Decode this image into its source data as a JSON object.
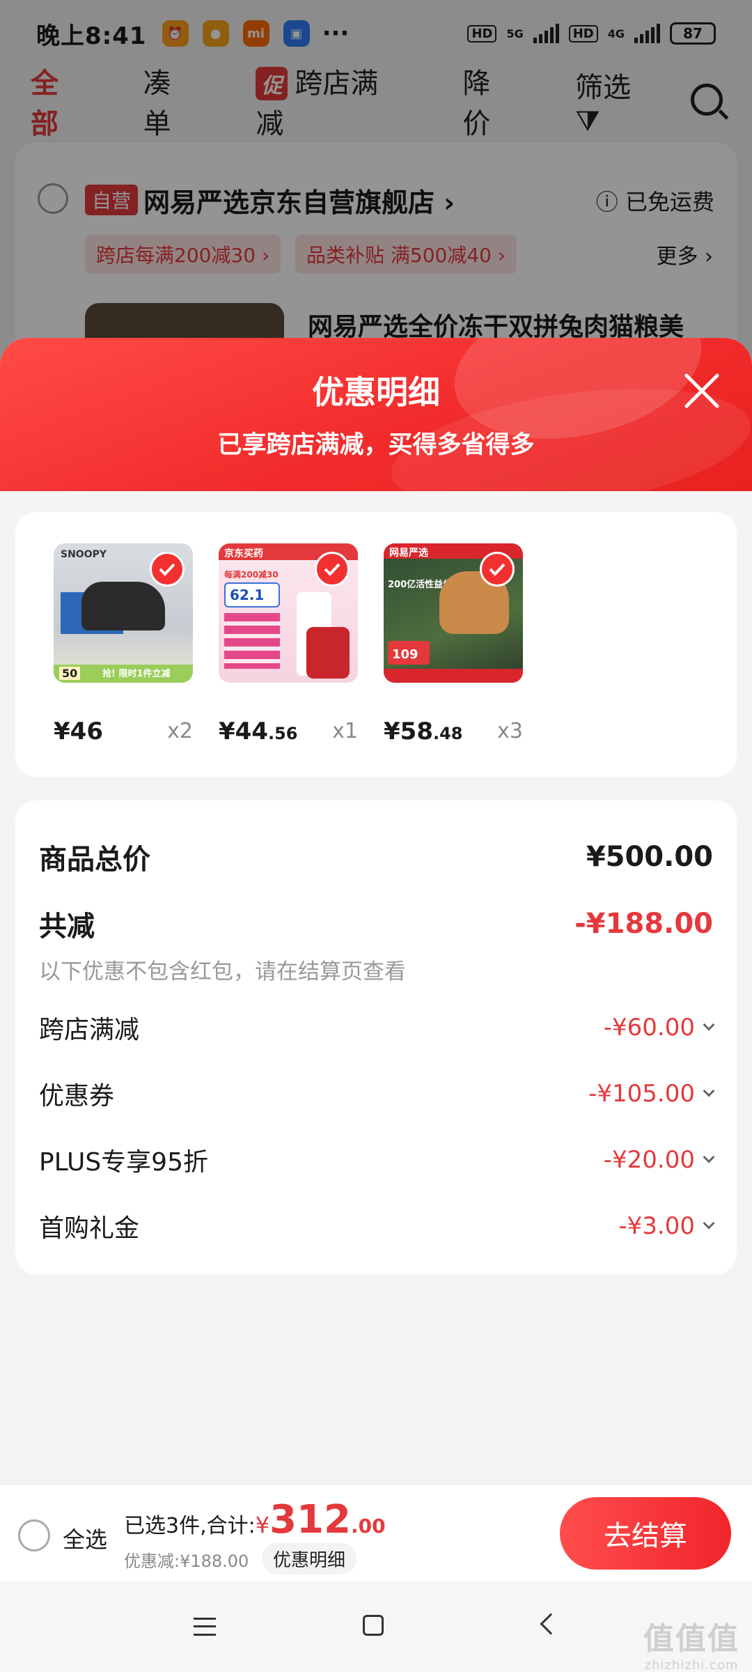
{
  "status_bar": {
    "time": "晚上8:41",
    "more": "···",
    "hd1": "HD",
    "net1": "5G",
    "hd2": "HD",
    "net2": "4G",
    "battery": "87"
  },
  "tabs": [
    {
      "label": "全部",
      "active": true
    },
    {
      "label": "凑单"
    },
    {
      "label": "跨店满减",
      "badge": "促"
    },
    {
      "label": "降价"
    },
    {
      "label": "筛选"
    }
  ],
  "store": {
    "badge": "自营",
    "name": "网易严选京东自营旗舰店 ›",
    "shipping": "已免运费",
    "coupons": [
      "跨店每满200减30 ›",
      "品类补贴  满500减40 ›"
    ],
    "more": "更多 ›",
    "product_title": "网易严选全价冻干双拼兔肉猫粮美"
  },
  "sheet": {
    "title": "优惠明细",
    "subtitle": "已享跨店满减，买得多省得多",
    "items": [
      {
        "price_main": "¥46",
        "price_cents": "",
        "qty": "x2",
        "img_label": "SNOOPY",
        "img_price": "50",
        "img_tag": "抢! 限时1件立减"
      },
      {
        "price_main": "¥44",
        "price_cents": ".56",
        "qty": "x1",
        "img_label": "京东买药",
        "img_price": "62.1",
        "img_tag": "每满200减30"
      },
      {
        "price_main": "¥58",
        "price_cents": ".48",
        "qty": "x3",
        "img_label": "网易严选",
        "img_price": "109",
        "img_tag": "200亿活性益生菌"
      }
    ],
    "total_label": "商品总价",
    "total_value": "¥500.00",
    "reduce_label": "共减",
    "reduce_value": "-¥188.00",
    "note": "以下优惠不包含红包，请在结算页查看",
    "lines": [
      {
        "label": "跨店满减",
        "value": "-¥60.00"
      },
      {
        "label": "优惠券",
        "value": "-¥105.00"
      },
      {
        "label": "PLUS专享95折",
        "value": "-¥20.00"
      },
      {
        "label": "首购礼金",
        "value": "-¥3.00"
      }
    ]
  },
  "checkout": {
    "select_all": "全选",
    "summary_prefix": "已选3件,合计:",
    "yen": "¥",
    "amount": "312",
    "cents": ".00",
    "discount": "优惠减:¥188.00",
    "detail_button": "优惠明细",
    "go_button": "去结算"
  },
  "watermark": {
    "main": "值值值",
    "sub": "zhizhizhi.com"
  },
  "colors": {
    "accent": "#e4393c",
    "header_red": "#f22c2c"
  }
}
